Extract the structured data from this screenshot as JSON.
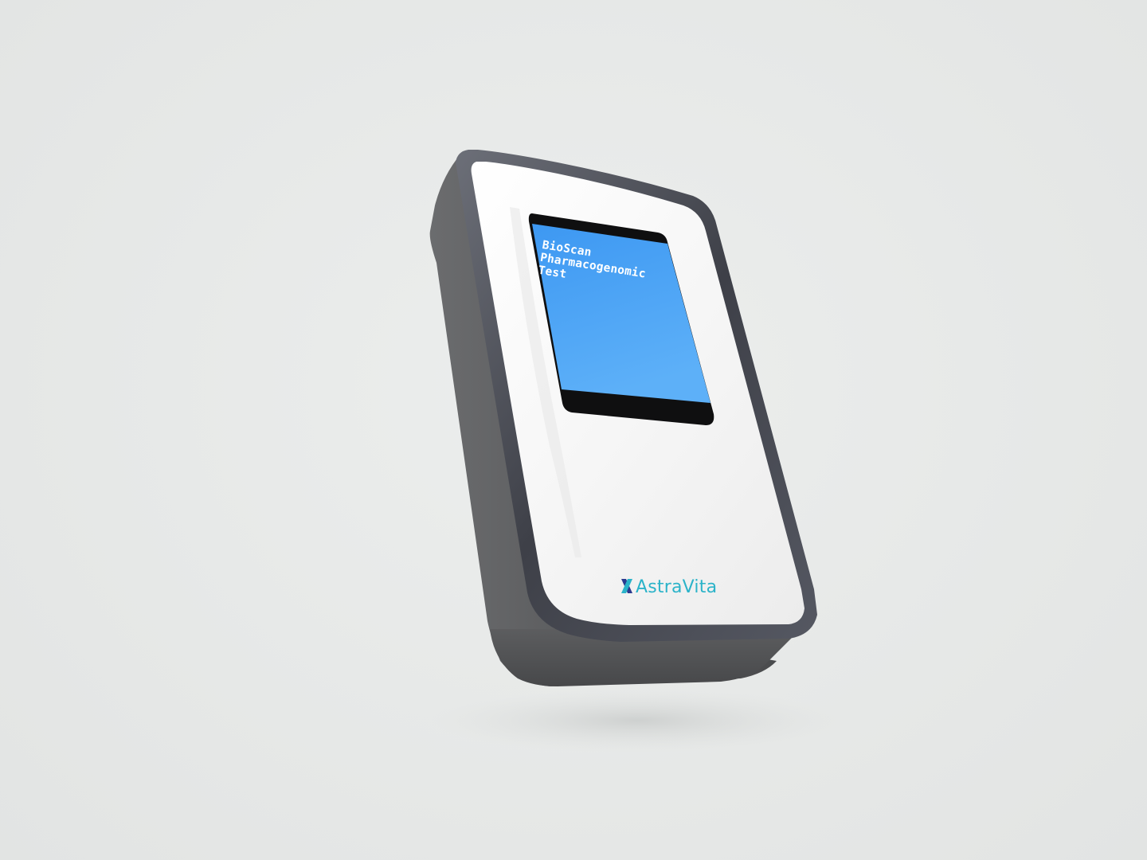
{
  "device": {
    "screen_lines": [
      "BioScan",
      "Pharmacogenomic",
      "Test"
    ],
    "brand_name": "AstraVita",
    "logo_icon": "dna-helix-icon"
  },
  "colors": {
    "background": "#e6e8e7",
    "shell_dark": "#5e5f61",
    "face_white": "#f7f7f7",
    "screen_blue": "#4aa3f5",
    "screen_bezel": "#111111",
    "brand_teal": "#2bb3c9",
    "brand_navy": "#2b3a8f"
  }
}
